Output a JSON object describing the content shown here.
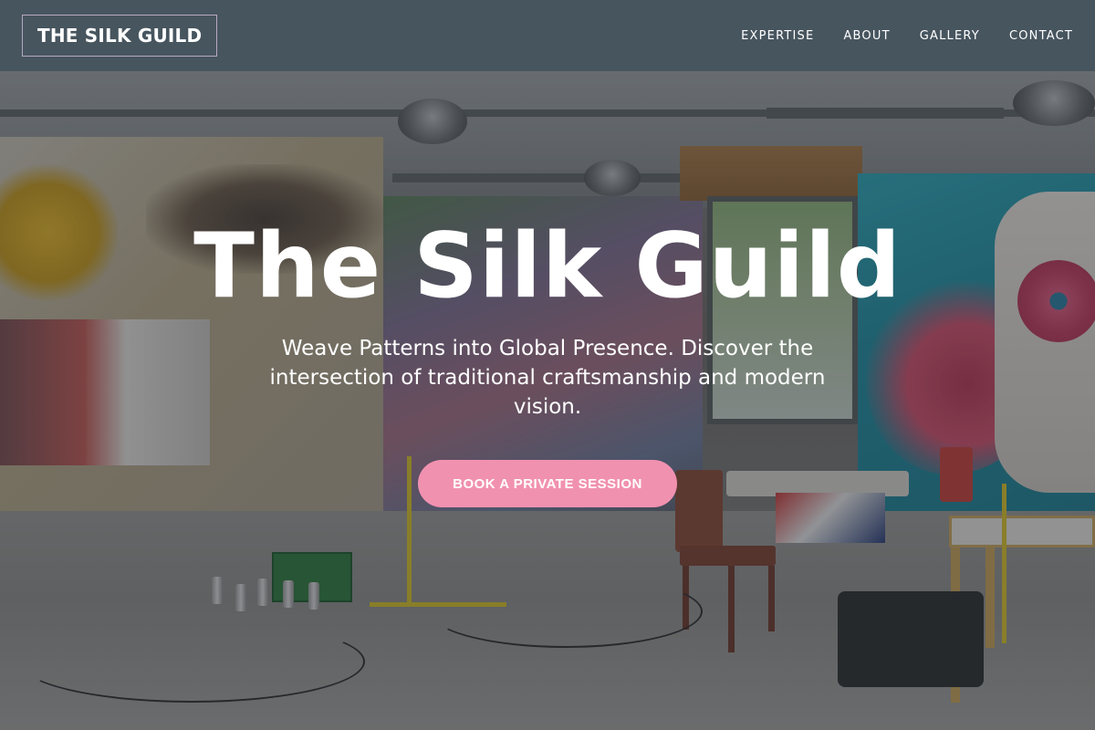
{
  "navbar": {
    "brand": "THE SILK GUILD",
    "links": [
      {
        "label": "EXPERTISE"
      },
      {
        "label": "ABOUT"
      },
      {
        "label": "GALLERY"
      },
      {
        "label": "CONTACT"
      }
    ]
  },
  "hero": {
    "title": "The Silk Guild",
    "subtitle": "Weave Patterns into Global Presence. Discover the intersection of traditional craftsmanship and modern vision.",
    "cta_label": "BOOK A PRIVATE SESSION",
    "background_image": "art studio with graffiti murals, chairs, tripods and equipment"
  },
  "colors": {
    "navbar_bg": "#47555f",
    "cta_bg": "#f191b0",
    "brand_border": "#b6a9c0",
    "text": "#ffffff"
  }
}
